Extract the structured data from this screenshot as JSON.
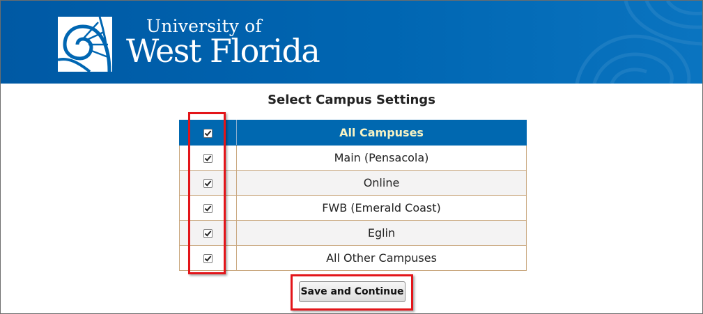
{
  "header": {
    "logo_line1": "University of",
    "logo_line2": "West Florida",
    "logo_icon": "nautilus-shell-icon",
    "background_color": "#0066b2"
  },
  "page": {
    "title": "Select Campus Settings"
  },
  "campus_table": {
    "header": {
      "label": "All Campuses",
      "checked": true
    },
    "rows": [
      {
        "label": "Main (Pensacola)",
        "checked": true
      },
      {
        "label": "Online",
        "checked": true
      },
      {
        "label": "FWB (Emerald Coast)",
        "checked": true
      },
      {
        "label": "Eglin",
        "checked": true
      },
      {
        "label": "All Other Campuses",
        "checked": true
      }
    ],
    "header_color": "#0068b0",
    "header_text_color": "#f7f3c4"
  },
  "actions": {
    "save_label": "Save and Continue"
  },
  "annotations": {
    "highlight_color": "#e3151a"
  }
}
